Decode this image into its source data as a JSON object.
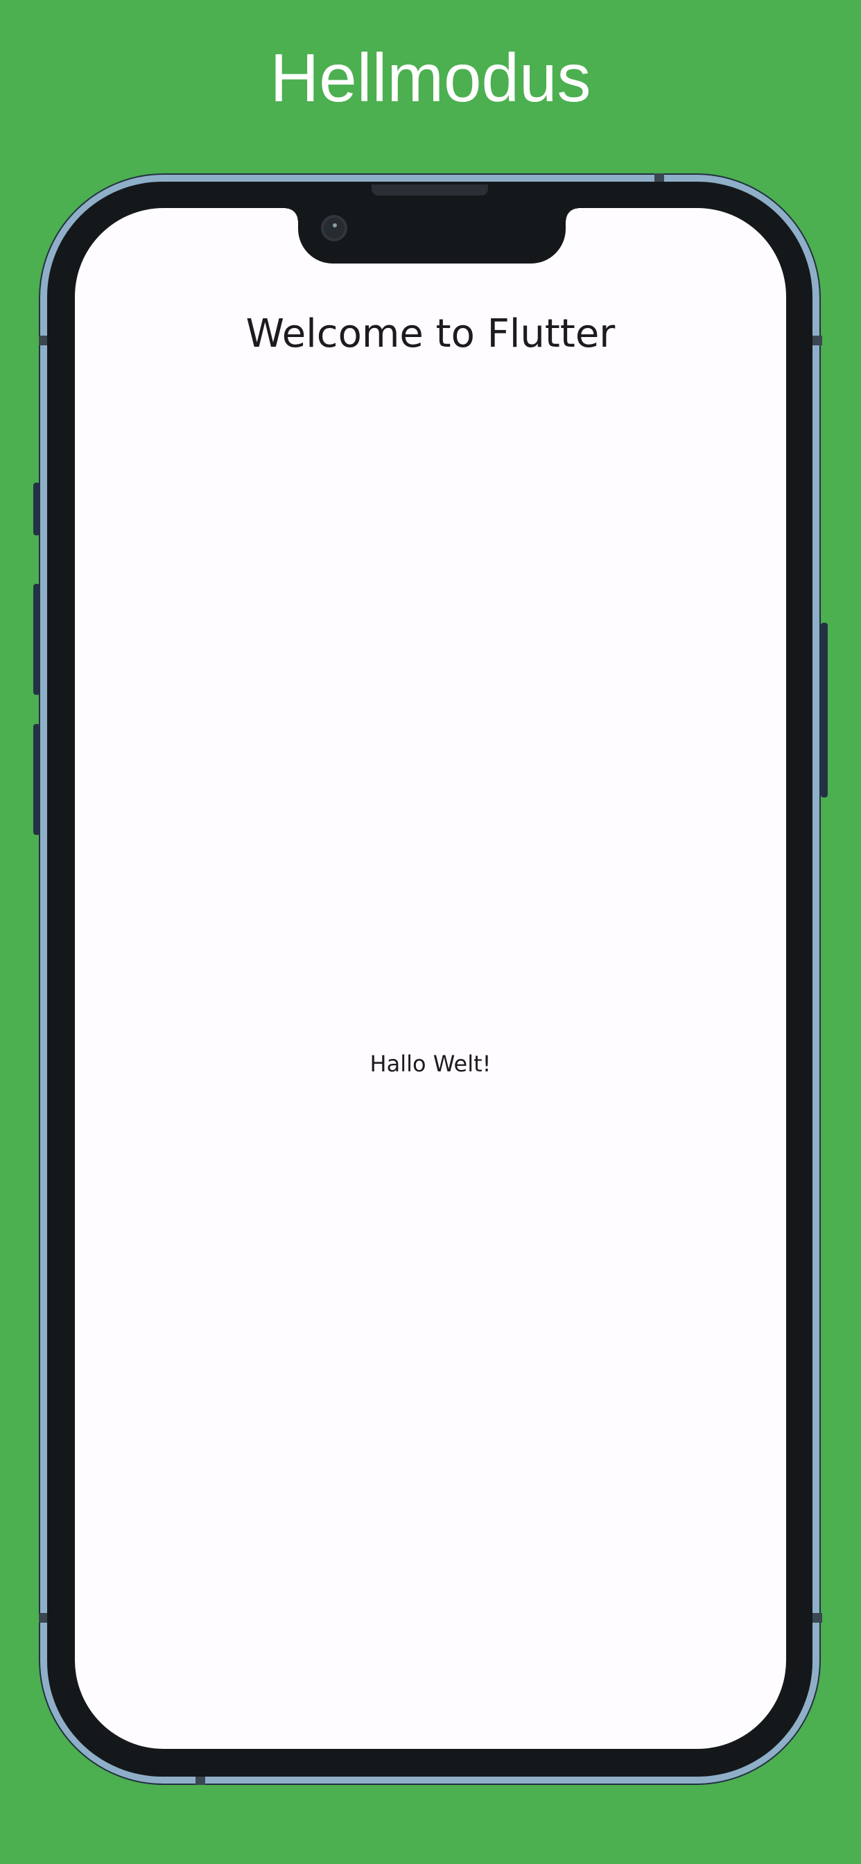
{
  "banner": {
    "title": "Hellmodus"
  },
  "app": {
    "title": "Welcome to Flutter",
    "body_text": "Hallo Welt!"
  },
  "colors": {
    "background": "#4CAF50",
    "phone_rim": "#8FAFC9",
    "phone_body": "#15181B",
    "screen": "#FFFCFF",
    "text": "#1D1B20"
  },
  "icons": {
    "camera": "front-camera-icon",
    "speaker": "earpiece-speaker-icon"
  }
}
